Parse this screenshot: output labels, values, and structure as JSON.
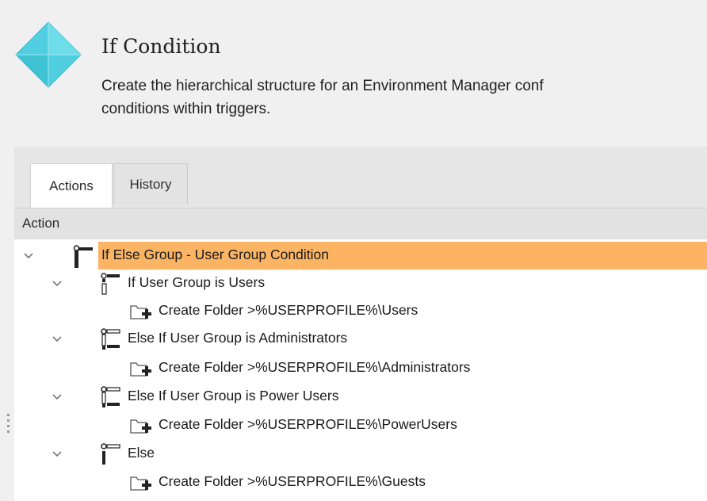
{
  "header": {
    "title": "If Condition",
    "description_line1": "Create the hierarchical structure for an Environment Manager conf",
    "description_line2": "conditions within triggers.",
    "icon": "diamond-icon",
    "icon_color": "#4fcfe0"
  },
  "tabs": [
    {
      "label": "Actions",
      "active": true
    },
    {
      "label": "History",
      "active": false
    }
  ],
  "table": {
    "column_header": "Action"
  },
  "tree": [
    {
      "label": "If Else Group - User Group Condition",
      "icon": "if-else-group-icon",
      "expanded": true,
      "selected": true
    },
    {
      "label": "If User Group is Users",
      "icon": "if-condition-icon",
      "expanded": true
    },
    {
      "label": "Create Folder >%USERPROFILE%\\Users",
      "icon": "create-folder-icon"
    },
    {
      "label": "Else If User Group is Administrators",
      "icon": "else-if-condition-icon",
      "expanded": true
    },
    {
      "label": "Create Folder >%USERPROFILE%\\Administrators",
      "icon": "create-folder-icon"
    },
    {
      "label": "Else If User Group is Power Users",
      "icon": "else-if-condition-icon",
      "expanded": true
    },
    {
      "label": "Create Folder >%USERPROFILE%\\PowerUsers",
      "icon": "create-folder-icon"
    },
    {
      "label": "Else",
      "icon": "else-condition-icon",
      "expanded": true
    },
    {
      "label": "Create Folder >%USERPROFILE%\\Guests",
      "icon": "create-folder-icon"
    }
  ],
  "colors": {
    "selection": "#fbb463",
    "background": "#f0f0f0"
  }
}
